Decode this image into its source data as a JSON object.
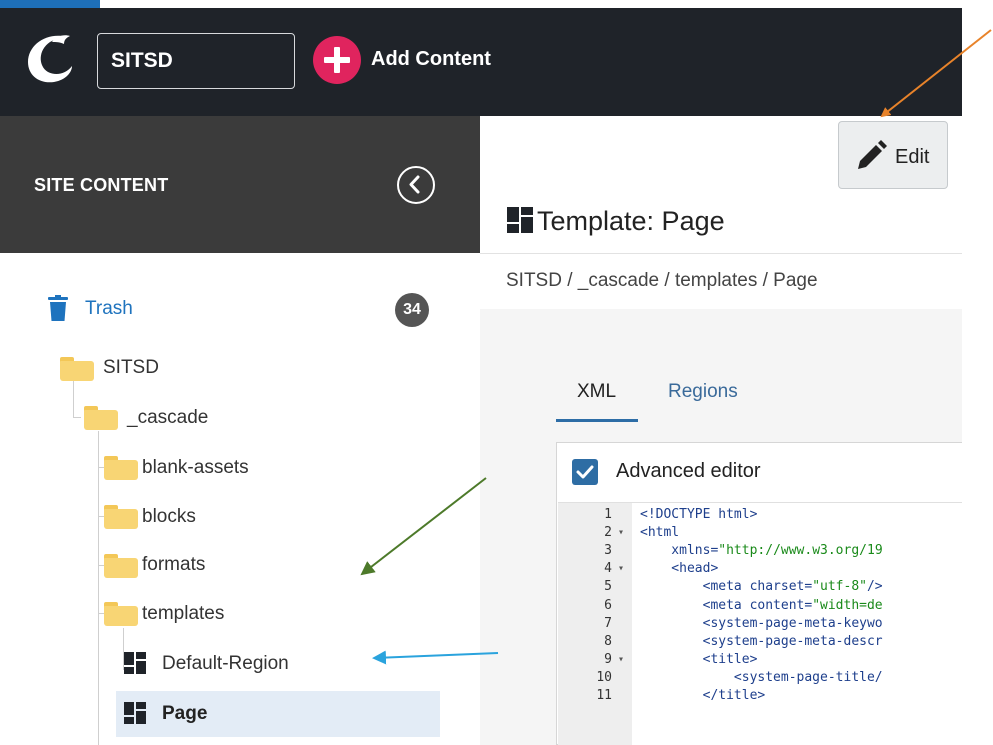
{
  "header": {
    "site": "SITSD",
    "add_content": "Add Content"
  },
  "sidebar": {
    "title": "SITE CONTENT",
    "trash": {
      "label": "Trash",
      "count": "34"
    },
    "tree": [
      {
        "label": "SITSD",
        "type": "folder"
      },
      {
        "label": "_cascade",
        "type": "folder"
      },
      {
        "label": "blank-assets",
        "type": "folder"
      },
      {
        "label": "blocks",
        "type": "folder"
      },
      {
        "label": "formats",
        "type": "folder"
      },
      {
        "label": "templates",
        "type": "folder"
      },
      {
        "label": "Default-Region",
        "type": "template"
      },
      {
        "label": "Page",
        "type": "template",
        "selected": true
      }
    ]
  },
  "main": {
    "edit_label": "Edit",
    "title": "Template: Page",
    "breadcrumb": "SITSD / _cascade / templates / Page",
    "tabs": [
      {
        "label": "XML",
        "active": true
      },
      {
        "label": "Regions",
        "active": false
      }
    ],
    "advanced_editor_label": "Advanced editor",
    "code_lines": [
      {
        "n": "1",
        "fold": "",
        "text": "<!DOCTYPE html>"
      },
      {
        "n": "2",
        "fold": "▾",
        "text": "<html"
      },
      {
        "n": "3",
        "fold": "",
        "text": "    xmlns=\"http://www.w3.org/19"
      },
      {
        "n": "4",
        "fold": "▾",
        "text": "    <head>"
      },
      {
        "n": "5",
        "fold": "",
        "text": "        <meta charset=\"utf-8\"/>"
      },
      {
        "n": "6",
        "fold": "",
        "text": "        <meta content=\"width=de"
      },
      {
        "n": "7",
        "fold": "",
        "text": "        <system-page-meta-keywo"
      },
      {
        "n": "8",
        "fold": "",
        "text": "        <system-page-meta-descr"
      },
      {
        "n": "9",
        "fold": "▾",
        "text": "        <title>"
      },
      {
        "n": "10",
        "fold": "",
        "text": "            <system-page-title/"
      },
      {
        "n": "11",
        "fold": "",
        "text": "        </title>"
      }
    ]
  },
  "colors": {
    "header_bg": "#1f2329",
    "sidebar_head_bg": "#3b3b3b",
    "accent_add": "#e0245e",
    "link_blue": "#1e73be",
    "arrow_orange": "#e8832a",
    "arrow_green": "#4d7a2a",
    "arrow_blue": "#2aa3dd"
  }
}
